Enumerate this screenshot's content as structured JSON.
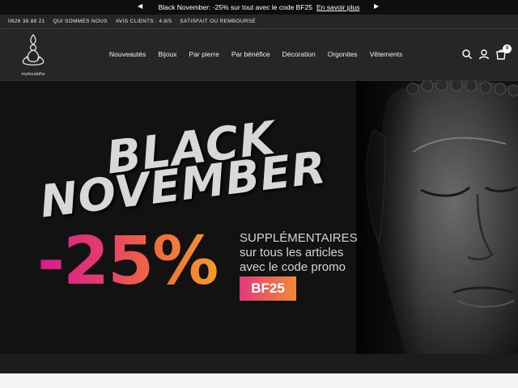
{
  "announcement": {
    "text": "Black November: -25% sur tout avec le code BF25",
    "link": "En savoir plus",
    "prev_icon": "arrow-left-icon",
    "next_icon": "arrow-right-icon"
  },
  "infobar": {
    "phone": "0826 38 88 21",
    "about": "QUI SOMMES NOUS",
    "reviews": "AVIS CLIENTS : 4.8/5",
    "guarantee": "SATISFAIT OU REMBOURSÉ"
  },
  "header": {
    "logo_text": "mybouddha",
    "nav": [
      "Nouveautés",
      "Bijoux",
      "Par pierre",
      "Par bénéfice",
      "Décoration",
      "Orgonites",
      "Vêtements"
    ],
    "cart_count": "0"
  },
  "hero": {
    "title_line1": "BLACK",
    "title_line2": "NOVEMBER",
    "discount": "-25%",
    "promo_line1": "SUPPLÉMENTAIRES",
    "promo_line2": "sur tous les articles",
    "promo_line3": "avec le code promo",
    "promo_code": "BF25"
  },
  "colors": {
    "background": "#1c1c1c",
    "gradient_start": "#d61a8c",
    "gradient_end": "#f39a2c"
  }
}
